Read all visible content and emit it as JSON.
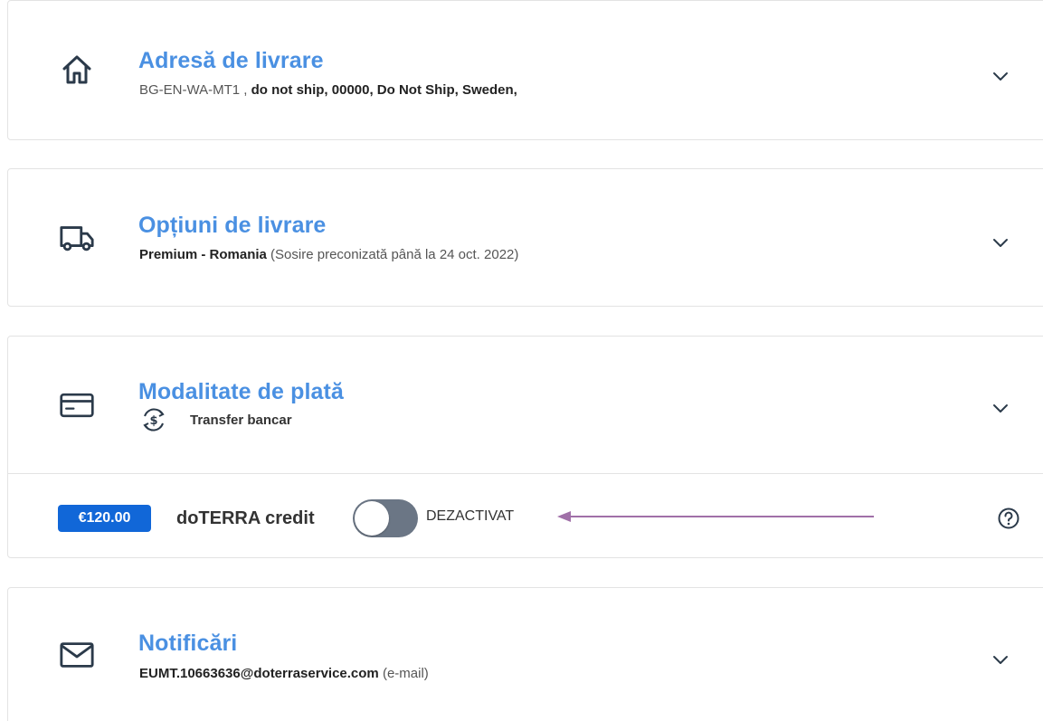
{
  "shipping_address": {
    "title": "Adresă de livrare",
    "name": "BG-EN-WA-MT1 ,",
    "address": "do not ship, 00000, Do Not Ship, Sweden,"
  },
  "shipping_options": {
    "title": "Opțiuni de livrare",
    "method": "Premium - Romania",
    "eta": "(Sosire preconizată până la 24 oct. 2022)"
  },
  "payment": {
    "title": "Modalitate de plată",
    "method": "Transfer bancar",
    "credit_amount": "€120.00",
    "credit_label": "doTERRA credit",
    "credit_state": "DEZACTIVAT",
    "credit_enabled": false
  },
  "notifications": {
    "title": "Notificări",
    "email": "EUMT.10663636@doterraservice.com",
    "channel": "(e-mail)"
  },
  "colors": {
    "title": "#4a90e2",
    "badge": "#1167d8",
    "toggle_off": "#6b7685",
    "annotation_arrow": "#a070a8"
  },
  "icons": [
    "home-icon",
    "truck-icon",
    "credit-card-icon",
    "dollar-exchange-icon",
    "envelope-icon",
    "chevron-down-icon",
    "help-icon"
  ]
}
